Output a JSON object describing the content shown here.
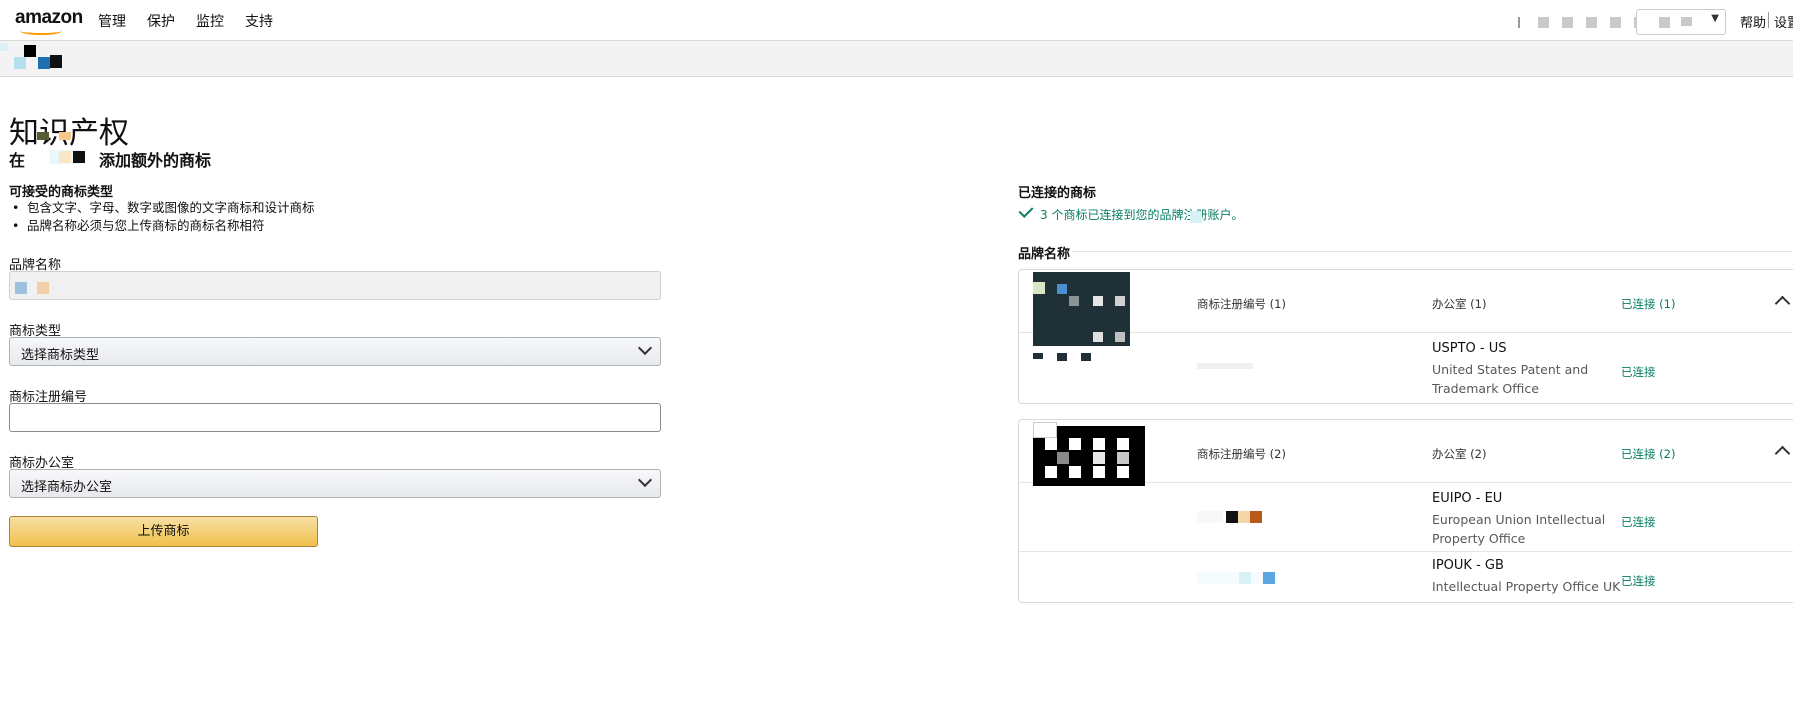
{
  "nav": {
    "logo": "amazon",
    "items": [
      "管理",
      "保护",
      "监控",
      "支持"
    ],
    "help": "帮助",
    "settings": "设置"
  },
  "page": {
    "title": "知识产权",
    "subtitle_pre": "在",
    "subtitle_post": "添加额外的商标"
  },
  "form": {
    "accepted_title": "可接受的商标类型",
    "bullets": [
      "包含文字、字母、数字或图像的文字商标和设计商标",
      "品牌名称必须与您上传商标的商标名称相符"
    ],
    "brand_label": "品牌名称",
    "type_label": "商标类型",
    "type_value": "选择商标类型",
    "reg_label": "商标注册编号",
    "office_label": "商标办公室",
    "office_value": "选择商标办公室",
    "upload_button": "上传商标"
  },
  "connected": {
    "title": "已连接的商标",
    "status": "3 个商标已连接到您的品牌注册账户。",
    "brand_header": "品牌名称",
    "cards": [
      {
        "reg_header": "商标注册编号 (1)",
        "office_header": "办公室 (1)",
        "status_header": "已连接 (1)",
        "rows": [
          {
            "office_code": "USPTO - US",
            "office_name": "United States Patent and Trademark Office",
            "status": "已连接"
          }
        ]
      },
      {
        "reg_header": "商标注册编号 (2)",
        "office_header": "办公室 (2)",
        "status_header": "已连接 (2)",
        "rows": [
          {
            "office_code": "EUIPO - EU",
            "office_name": "European Union Intellectual Property Office",
            "status": "已连接"
          },
          {
            "office_code": "IPOUK - GB",
            "office_name": "Intellectual Property Office UK",
            "status": "已连接"
          }
        ]
      }
    ]
  },
  "colors": {
    "accent_green": "#067d62",
    "button_yellow": "#f0c14b",
    "logo_orange": "#ff9900"
  }
}
